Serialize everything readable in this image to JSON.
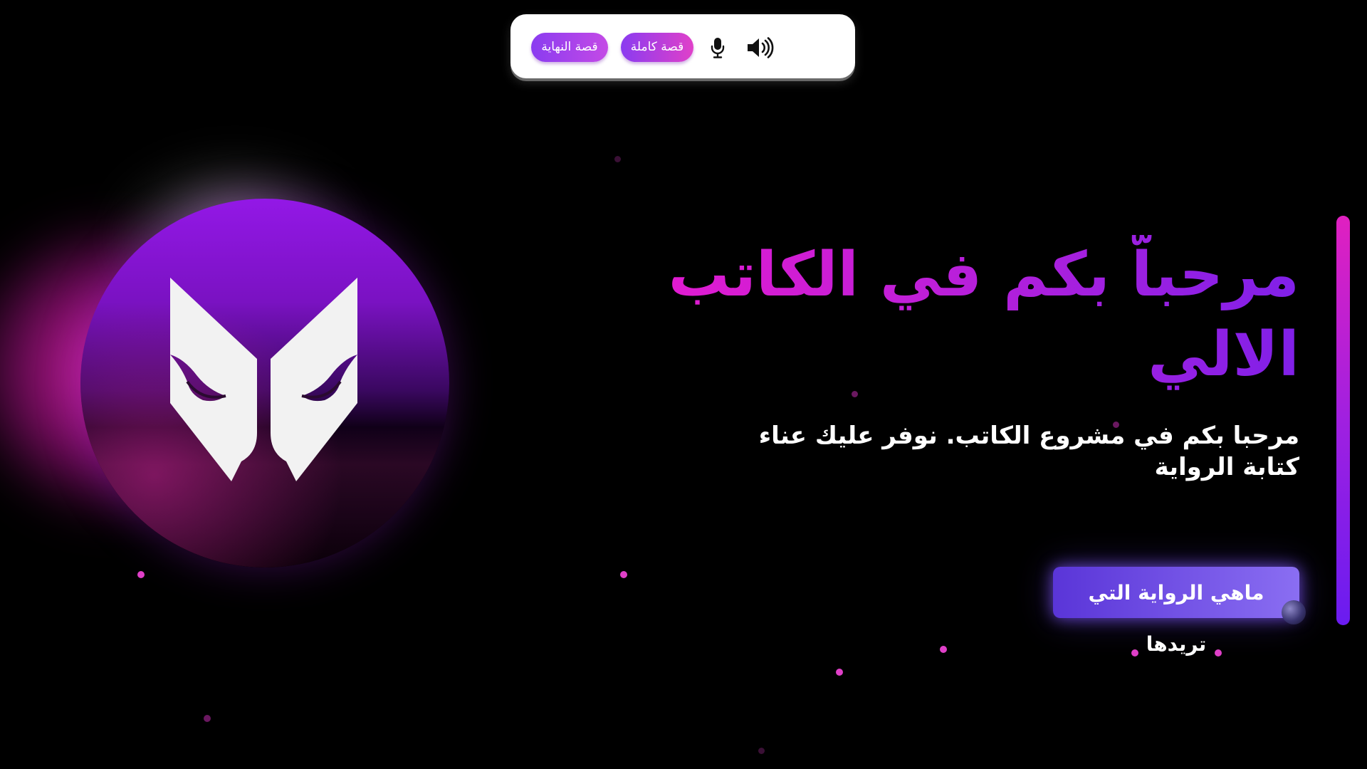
{
  "toolbar": {
    "end_story_label": "قصة النهاية",
    "full_story_label": "قصة كاملة",
    "mic_icon": "microphone-icon",
    "speaker_icon": "speaker-volume-icon"
  },
  "hero": {
    "title": "مرحباّ بكم في الكاتب الالي",
    "subtitle": "مرحبا بكم في مشروع الكاتب. نوفر عليك عناء كتابة الرواية",
    "cta_label": "ماهي الرواية التي تريدها"
  },
  "logo": {
    "icon": "writer-logo-icon"
  },
  "colors": {
    "background": "#000000",
    "accent_pink": "#e21bd0",
    "accent_purple": "#8020e8",
    "cta_start": "#5a35d8",
    "cta_end": "#8a6ef2"
  }
}
